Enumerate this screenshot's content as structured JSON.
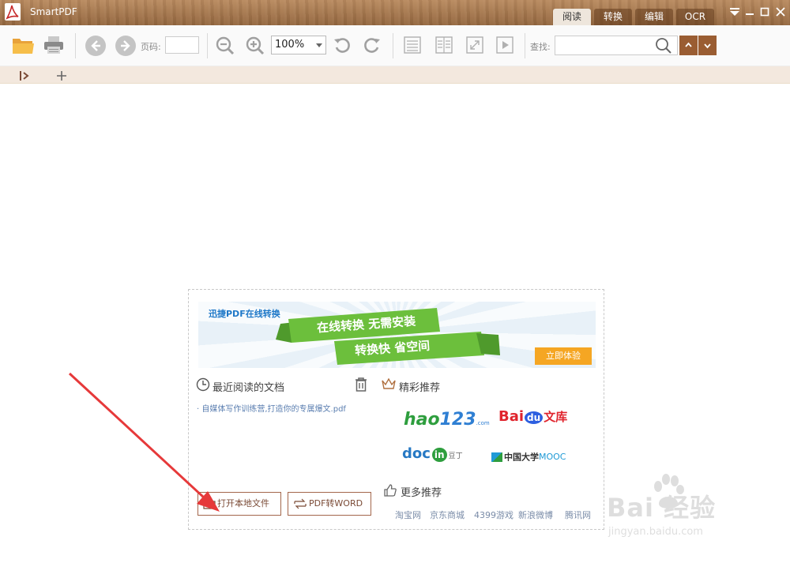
{
  "window": {
    "title": "SmartPDF",
    "mode_tabs": [
      {
        "label": "阅读",
        "active": true
      },
      {
        "label": "转换",
        "active": false
      },
      {
        "label": "编辑",
        "active": false
      },
      {
        "label": "OCR",
        "active": false
      }
    ]
  },
  "toolbar": {
    "page_label": "页码:",
    "page_value": "",
    "zoom_value": "100%",
    "find_label": "查找:",
    "search_value": ""
  },
  "start_panel": {
    "banner": {
      "small_title": "迅捷PDF在线转换",
      "ribbon_top": "在线转换 无需安装",
      "ribbon_bottom": "转换快 省空间",
      "cta_label": "立即体验"
    },
    "recent": {
      "heading": "最近阅读的文档",
      "files": [
        "自媒体写作训练营,打造你的专属爆文.pdf"
      ]
    },
    "featured": {
      "heading": "精彩推荐",
      "logos": [
        {
          "name": "hao123",
          "text_main": "hao",
          "text_num": "123",
          "text_suffix": ".com"
        },
        {
          "name": "baidu-wenku",
          "text_main": "Bai",
          "text_mid": "du",
          "text_suffix": "文库"
        },
        {
          "name": "docin",
          "text_main": "doc",
          "text_mid": "in",
          "text_suffix": "豆丁"
        },
        {
          "name": "mooc",
          "text_main": "中国大学",
          "text_suffix": "MOOC"
        }
      ]
    },
    "more": {
      "heading": "更多推荐",
      "links": [
        "淘宝网",
        "京东商城",
        "4399游戏",
        "新浪微博",
        "腾讯网"
      ]
    },
    "actions": {
      "open_local": "打开本地文件",
      "pdf_to_word": "PDF转WORD"
    }
  },
  "watermark": {
    "main": "Bai 经验",
    "sub": "jingyan.baidu.com"
  },
  "colors": {
    "titlebar": "#a87a50",
    "accent": "#9a5d32",
    "tabstrip": "#f3e8de",
    "banner_green": "#6cbf3c",
    "cta_orange": "#f5a623",
    "arrow_red": "#e6393a"
  }
}
